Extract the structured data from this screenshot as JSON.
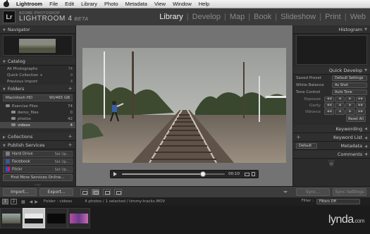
{
  "menubar": {
    "items": [
      "Lightroom",
      "File",
      "Edit",
      "Library",
      "Photo",
      "Metadata",
      "View",
      "Window",
      "Help"
    ]
  },
  "identity": {
    "logo": "Lr",
    "brand_top": "ADOBE PHOTOSHOP",
    "brand_main": "LIGHTROOM 4",
    "brand_tag": "BETA"
  },
  "modules": [
    "Library",
    "Develop",
    "Map",
    "Book",
    "Slideshow",
    "Print",
    "Web"
  ],
  "active_module": "Library",
  "left_panel": {
    "navigator": {
      "title": "Navigator"
    },
    "catalog": {
      "title": "Catalog",
      "items": [
        {
          "label": "All Photographs",
          "count": "74"
        },
        {
          "label": "Quick Collection +",
          "count": "0"
        },
        {
          "label": "Previous Import",
          "count": "4"
        }
      ]
    },
    "folders": {
      "title": "Folders",
      "drive": {
        "label": "Macintosh HD",
        "meta": "90/465 GB"
      },
      "items": [
        {
          "label": "Exercise Files",
          "count": "74"
        },
        {
          "label": "demo_files",
          "count": "0"
        },
        {
          "label": "photos",
          "count": "42"
        },
        {
          "label": "videos",
          "count": "4"
        }
      ]
    },
    "collections": {
      "title": "Collections"
    },
    "publish": {
      "title": "Publish Services",
      "items": [
        {
          "label": "Hard Drive",
          "action": "Set Up..."
        },
        {
          "label": "Facebook",
          "action": "Set Up..."
        },
        {
          "label": "Flickr",
          "action": "Set Up..."
        }
      ],
      "find_more": "Find More Services Online..."
    }
  },
  "right_panel": {
    "histogram": "Histogram",
    "quick_develop": {
      "title": "Quick Develop",
      "saved_preset_label": "Saved Preset",
      "saved_preset_value": "Default Settings",
      "white_balance_label": "White Balance",
      "white_balance_value": "As Shot",
      "tone_control_label": "Tone Control",
      "tone_control_button": "Auto Tone",
      "adjustments": [
        "Exposure",
        "Clarity",
        "Vibrance"
      ],
      "reset_all": "Reset All"
    },
    "keywording": "Keywording",
    "keyword_list": "Keyword List",
    "metadata": {
      "title": "Metadata",
      "preset": "Default"
    },
    "comments": "Comments"
  },
  "video": {
    "time": "00:10",
    "progress": 0.79
  },
  "toolbar": {
    "import": "Import...",
    "export": "Export...",
    "sync": "Sync...",
    "sync_settings": "Sync Settings"
  },
  "filmstrip_header": {
    "monitors": [
      "1",
      "2"
    ],
    "source": "Folder : videos",
    "status": "4 photos / 1 selected / timmy-tracks.MOV",
    "filter_label": "Filter :",
    "filter_value": "Filters Off"
  },
  "watermark": {
    "main": "lynda",
    "suffix": ".com"
  }
}
